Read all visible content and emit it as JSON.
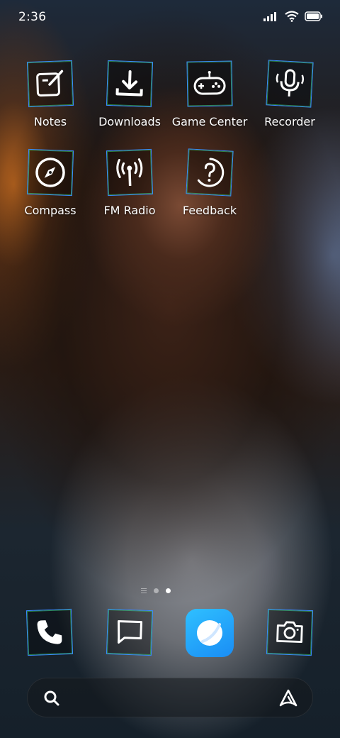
{
  "status_bar": {
    "time": "2:36",
    "icons": [
      "signal-icon",
      "wifi-icon",
      "battery-icon"
    ]
  },
  "apps": [
    {
      "label": "Notes",
      "icon": "notes-icon"
    },
    {
      "label": "Downloads",
      "icon": "download-icon"
    },
    {
      "label": "Game Center",
      "icon": "gamepad-icon"
    },
    {
      "label": "Recorder",
      "icon": "microphone-icon"
    },
    {
      "label": "Compass",
      "icon": "compass-icon"
    },
    {
      "label": "FM Radio",
      "icon": "radio-antenna-icon"
    },
    {
      "label": "Feedback",
      "icon": "question-icon"
    }
  ],
  "page_indicator": {
    "pages": 2,
    "active_page": 2
  },
  "dock": [
    {
      "icon": "phone-icon"
    },
    {
      "icon": "message-icon"
    },
    {
      "icon": "browser-icon"
    },
    {
      "icon": "camera-icon"
    }
  ],
  "search_bar": {
    "icon": "search-icon",
    "assistant_icon": "assistant-icon"
  },
  "colors": {
    "icon_outline": "#3b8cff",
    "icon_glow": "#3cdc6e",
    "browser_accent": "#1a8df5"
  }
}
